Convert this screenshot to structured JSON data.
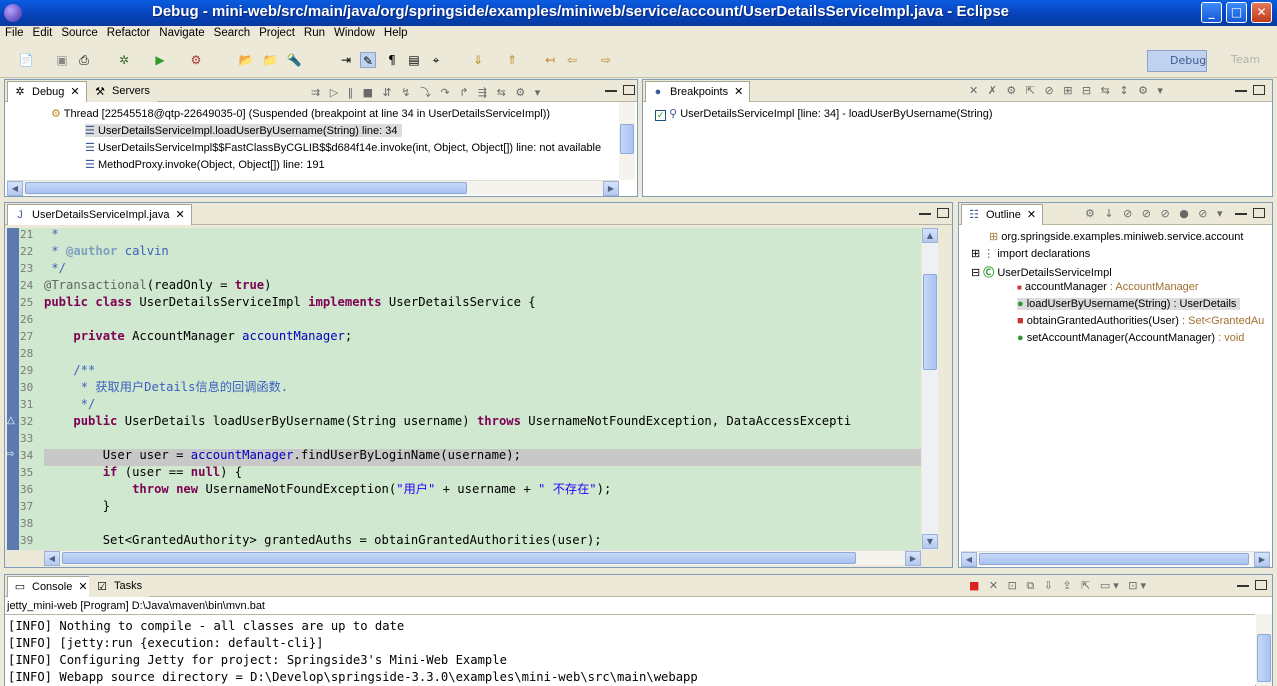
{
  "window": {
    "title": "Debug - mini-web/src/main/java/org/springside/examples/miniweb/service/account/UserDetailsServiceImpl.java - Eclipse",
    "minimize": "_",
    "maximize": "□",
    "close": "✕"
  },
  "menu": [
    "File",
    "Edit",
    "Source",
    "Refactor",
    "Navigate",
    "Search",
    "Project",
    "Run",
    "Window",
    "Help"
  ],
  "perspectives": {
    "active": "Debug",
    "inactive": "Team"
  },
  "debug_view": {
    "tabs": [
      "Debug",
      "Servers"
    ],
    "thread": "Thread [22545518@qtp-22649035-0] (Suspended (breakpoint at line 34 in UserDetailsServiceImpl))",
    "frames": [
      "UserDetailsServiceImpl.loadUserByUsername(String) line: 34",
      "UserDetailsServiceImpl$$FastClassByCGLIB$$d684f14e.invoke(int, Object, Object[]) line: not available",
      "MethodProxy.invoke(Object, Object[]) line: 191"
    ]
  },
  "breakpoints_view": {
    "tab": "Breakpoints",
    "items": [
      "UserDetailsServiceImpl [line: 34] - loadUserByUsername(String)"
    ]
  },
  "editor": {
    "tab": "UserDetailsServiceImpl.java",
    "line_numbers": [
      "21",
      "22",
      "23",
      "24",
      "25",
      "26",
      "27",
      "28",
      "29",
      "30",
      "31",
      "32",
      "33",
      "34",
      "35",
      "36",
      "37",
      "38",
      "39"
    ],
    "lines": [
      " *",
      " * @author calvin",
      " */",
      "@Transactional(readOnly = true)",
      "public class UserDetailsServiceImpl implements UserDetailsService {",
      "",
      "    private AccountManager accountManager;",
      "",
      "    /**",
      "     * 获取用户Details信息的回调函数.",
      "     */",
      "    public UserDetails loadUserByUsername(String username) throws UsernameNotFoundException, DataAccessExcepti",
      "",
      "        User user = accountManager.findUserByLoginName(username);",
      "        if (user == null) {",
      "            throw new UsernameNotFoundException(\"用户\" + username + \" 不存在\");",
      "        }",
      "",
      "        Set<GrantedAuthority> grantedAuths = obtainGrantedAuthorities(user);"
    ]
  },
  "outline_view": {
    "tab": "Outline",
    "package": "org.springside.examples.miniweb.service.account",
    "imports": "import declarations",
    "class": "UserDetailsServiceImpl",
    "members": [
      {
        "name": "accountManager",
        "type": " : AccountManager"
      },
      {
        "name": "loadUserByUsername(String)",
        "type": " : UserDetails"
      },
      {
        "name": "obtainGrantedAuthorities(User)",
        "type": " : Set<GrantedAu"
      },
      {
        "name": "setAccountManager(AccountManager)",
        "type": " : void"
      }
    ]
  },
  "console_view": {
    "tabs": [
      "Console",
      "Tasks"
    ],
    "process": "jetty_mini-web [Program] D:\\Java\\maven\\bin\\mvn.bat",
    "lines": [
      "[INFO] Nothing to compile - all classes are up to date",
      "[INFO] [jetty:run {execution: default-cli}]",
      "[INFO] Configuring Jetty for project: Springside3's Mini-Web Example",
      "[INFO] Webapp source directory = D:\\Develop\\springside-3.3.0\\examples\\mini-web\\src\\main\\webapp"
    ]
  },
  "colors": {
    "editor_bg": "#cfe8cf",
    "current_line": "#c8c8c8",
    "keyword": "#7f0055",
    "title_bar": "#0742b8"
  }
}
